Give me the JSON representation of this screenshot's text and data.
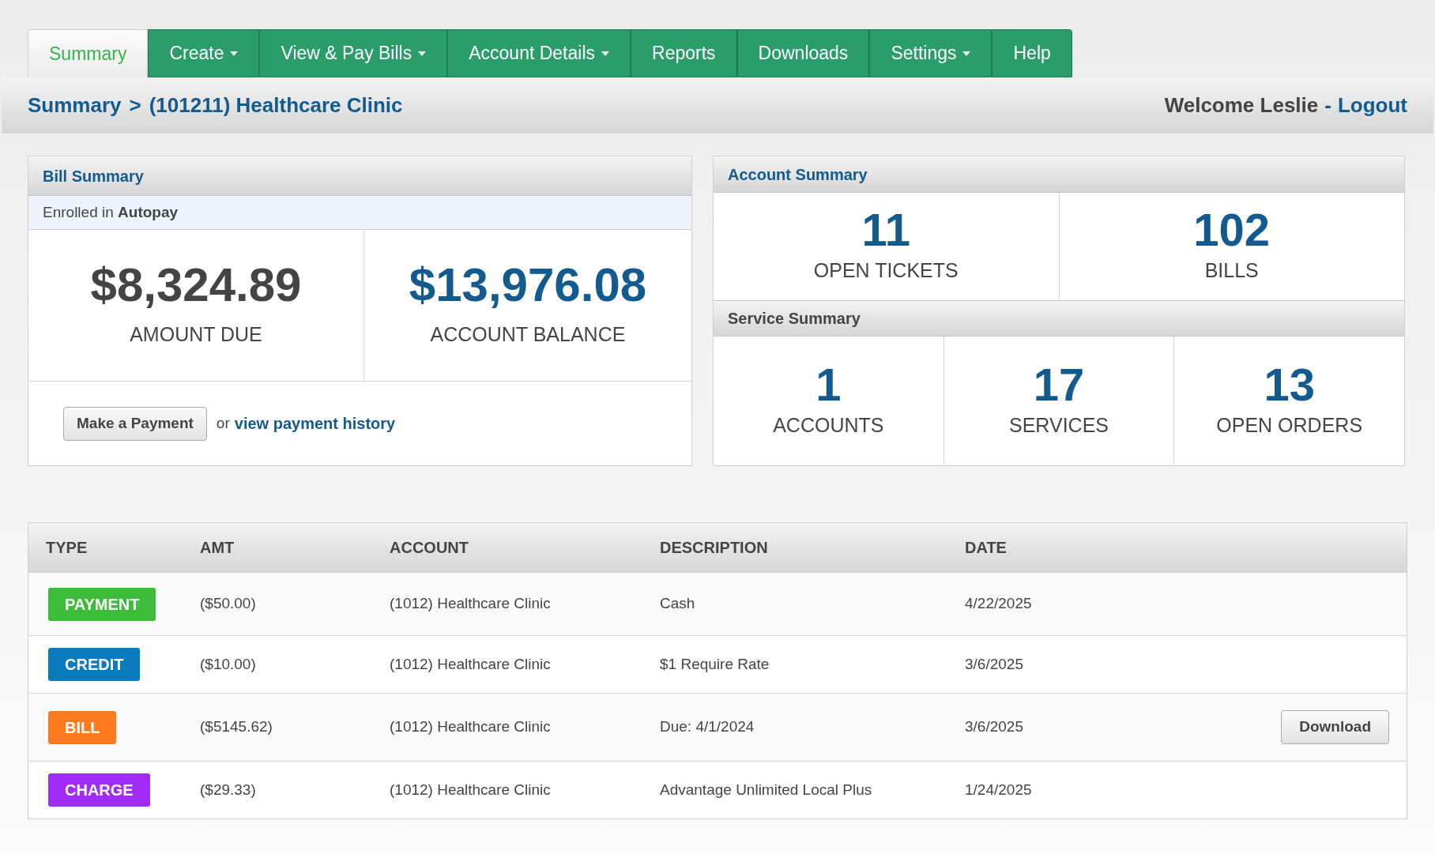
{
  "nav": {
    "tabs": [
      {
        "label": "Summary",
        "selected": true,
        "has_menu": false
      },
      {
        "label": "Create",
        "selected": false,
        "has_menu": true
      },
      {
        "label": "View & Pay Bills",
        "selected": false,
        "has_menu": true
      },
      {
        "label": "Account Details",
        "selected": false,
        "has_menu": true
      },
      {
        "label": "Reports",
        "selected": false,
        "has_menu": false
      },
      {
        "label": "Downloads",
        "selected": false,
        "has_menu": false
      },
      {
        "label": "Settings",
        "selected": false,
        "has_menu": true
      },
      {
        "label": "Help",
        "selected": false,
        "has_menu": false
      }
    ]
  },
  "breadcrumb": {
    "items": [
      "Summary",
      "(101211) Healthcare Clinic"
    ],
    "separator": ">"
  },
  "welcome": {
    "text": "Welcome Leslie",
    "separator": "-",
    "link": "Logout"
  },
  "bill_summary": {
    "title": "Bill Summary",
    "enrollment": "Enrolled in **Autopay**",
    "amounts": [
      {
        "kind": "due",
        "value": "$8,324.89",
        "label": "AMOUNT DUE"
      },
      {
        "kind": "balance",
        "value": "$13,976.08",
        "label": "ACCOUNT BALANCE"
      }
    ],
    "payment_button": "Make a Payment",
    "or_text": "or",
    "history_link": "view payment history"
  },
  "account_summary": {
    "title": "Account Summary",
    "stats": [
      {
        "value": "11",
        "label": "OPEN TICKETS"
      },
      {
        "value": "102",
        "label": "BILLS"
      }
    ]
  },
  "service_summary": {
    "title": "Service Summary",
    "stats": [
      {
        "value": "1",
        "label": "ACCOUNTS"
      },
      {
        "value": "17",
        "label": "SERVICES"
      },
      {
        "value": "13",
        "label": "OPEN ORDERS"
      }
    ]
  },
  "table": {
    "columns": [
      "TYPE",
      "AMT",
      "ACCOUNT",
      "DESCRIPTION",
      "DATE"
    ],
    "rows": [
      {
        "type": "PAYMENT",
        "color": "#3dbb3a",
        "amt": "($50.00)",
        "account": "(1012) Healthcare Clinic",
        "description": "Cash",
        "date": "4/22/2025"
      },
      {
        "type": "CREDIT",
        "color": "#0a7bbd",
        "amt": "($10.00)",
        "account": "(1012) Healthcare Clinic",
        "description": "$1 Require Rate",
        "date": "3/6/2025"
      },
      {
        "type": "BILL",
        "color": "#ff7a1f",
        "amt": "($5145.62)",
        "account": "(1012) Healthcare Clinic",
        "description": "Due: 4/1/2024",
        "date": "3/6/2025",
        "action": "Download"
      },
      {
        "type": "CHARGE",
        "color": "#a12cf5",
        "amt": "($29.33)",
        "account": "(1012) Healthcare Clinic",
        "description": "Advantage Unlimited Local Plus",
        "date": "1/24/2025"
      }
    ]
  }
}
